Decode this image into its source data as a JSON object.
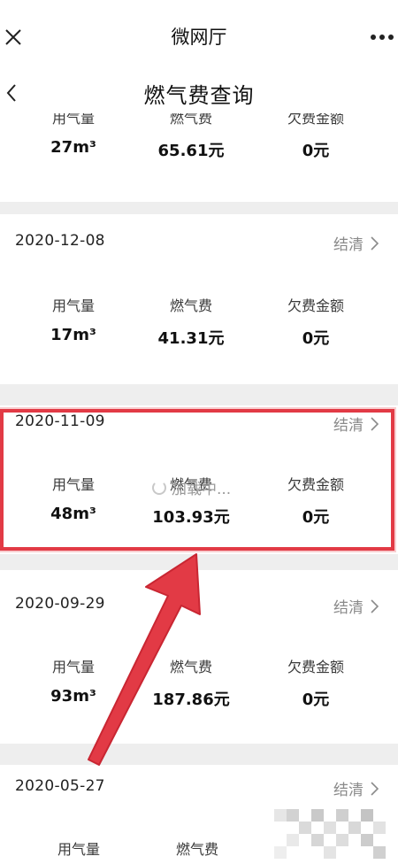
{
  "topbar": {
    "title": "微网厅"
  },
  "header": {
    "title": "燃气费查询"
  },
  "columns": {
    "usage": "用气量",
    "fee": "燃气费",
    "owed": "欠费金额"
  },
  "records": [
    {
      "date": "",
      "status": "",
      "usage": "27m³",
      "fee": "65.61元",
      "owed": "0元"
    },
    {
      "date": "2020-12-08",
      "status": "结清",
      "usage": "17m³",
      "fee": "41.31元",
      "owed": "0元"
    },
    {
      "date": "2020-11-09",
      "status": "结清",
      "usage": "48m³",
      "fee": "103.93元",
      "owed": "0元"
    },
    {
      "date": "2020-09-29",
      "status": "结清",
      "usage": "93m³",
      "fee": "187.86元",
      "owed": "0元"
    },
    {
      "date": "2020-05-27",
      "status": "结清",
      "usage": "",
      "fee": "",
      "owed": ""
    }
  ],
  "loading": {
    "text": "加载中..."
  },
  "colors": {
    "highlight": "#e23a45",
    "separator": "#eeeeee"
  },
  "icons": {
    "close": "close-icon",
    "more": "more-icon",
    "back": "back-icon",
    "chevron": "chevron-right-icon"
  }
}
